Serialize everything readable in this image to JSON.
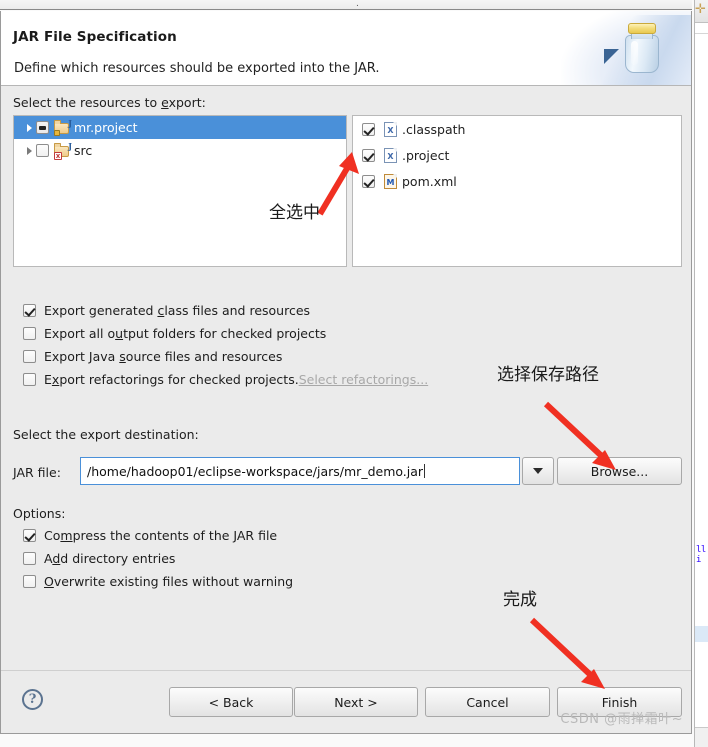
{
  "window": {
    "title_dot": "."
  },
  "banner": {
    "title": "JAR File Specification",
    "subtitle": "Define which resources should be exported into the JAR.",
    "icon": "jar-bottle-icon"
  },
  "resources": {
    "label": "Select the resources to export:",
    "tree": [
      {
        "label": "mr.project",
        "checked": "partial",
        "selected": true,
        "expandable": true,
        "icon": "java-project-icon"
      },
      {
        "label": "src",
        "checked": "unchecked",
        "selected": false,
        "expandable": true,
        "icon": "java-source-folder-icon"
      }
    ],
    "files": [
      {
        "label": ".classpath",
        "checked": true,
        "icon": "xml-file-icon",
        "badge": "X"
      },
      {
        "label": ".project",
        "checked": true,
        "icon": "xml-file-icon",
        "badge": "X"
      },
      {
        "label": "pom.xml",
        "checked": true,
        "icon": "maven-file-icon",
        "badge": "M"
      }
    ]
  },
  "export_options": [
    {
      "label_pre": "Export generated ",
      "mnemonic": "c",
      "label_post": "lass files and resources",
      "checked": true
    },
    {
      "label_pre": "Export all o",
      "mnemonic": "u",
      "label_post": "tput folders for checked projects",
      "checked": false
    },
    {
      "label_pre": "Export Java ",
      "mnemonic": "s",
      "label_post": "ource files and resources",
      "checked": false
    },
    {
      "label_pre": "E",
      "mnemonic": "x",
      "label_post": "port refactorings for checked projects.",
      "checked": false,
      "link": "Select refactorings..."
    }
  ],
  "destination": {
    "label": "Select the export destination:",
    "field_label_pre": "J",
    "field_label_mnemonic": "A",
    "field_label_post": "R file:",
    "jar_path": "/home/hadoop01/eclipse-workspace/jars/mr_demo.jar",
    "dropdown_icon": "chevron-down-icon",
    "browse_label": "Browse..."
  },
  "options": {
    "label": "Options:",
    "items": [
      {
        "label_pre": "Co",
        "mnemonic": "m",
        "label_post": "press the contents of the JAR file",
        "checked": true
      },
      {
        "label_pre": "A",
        "mnemonic": "d",
        "label_post": "d directory entries",
        "checked": false
      },
      {
        "label_pre": "",
        "mnemonic": "O",
        "label_post": "verwrite existing files without warning",
        "checked": false
      }
    ]
  },
  "footer": {
    "help_glyph": "?",
    "buttons": [
      {
        "label": "< Back",
        "name": "back-button"
      },
      {
        "label": "Next >",
        "name": "next-button"
      },
      {
        "label": "Cancel",
        "name": "cancel-button"
      },
      {
        "label": "Finish",
        "name": "finish-button"
      }
    ]
  },
  "annotations": [
    {
      "text": "全选中",
      "meaning": "all-selected"
    },
    {
      "text": "选择保存路径",
      "meaning": "choose-save-path"
    },
    {
      "text": "完成",
      "meaning": "finish"
    }
  ],
  "watermark": "CSDN @雨掸霜叶~",
  "colors": {
    "selection_blue": "#4a90d9",
    "annotation_red": "#f03022",
    "dialog_bg": "#ebebeb",
    "banner_bg": "#ffffff"
  }
}
